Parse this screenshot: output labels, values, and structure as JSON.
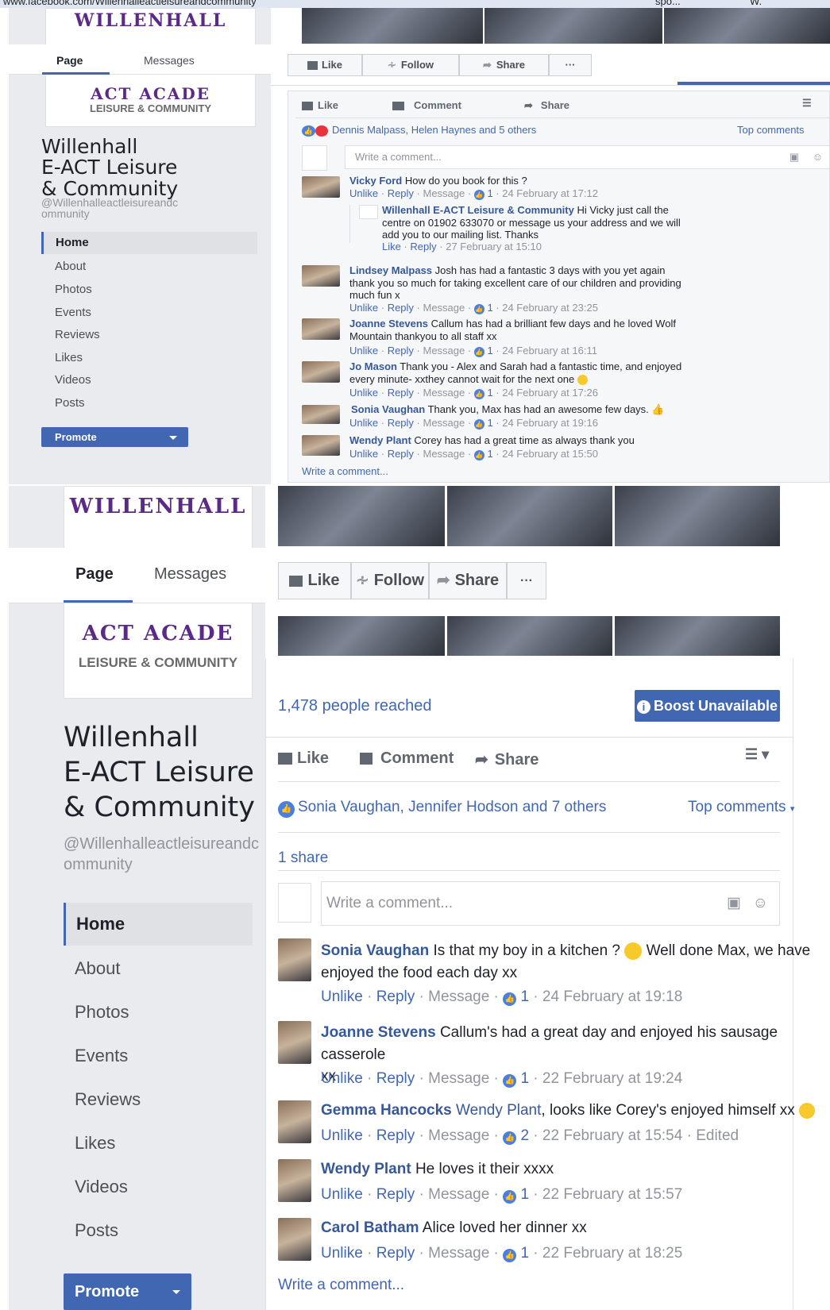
{
  "browser": {
    "address": "www.facebook.com/Willenhalleactleisureandcommunity",
    "tab_text": "spo...",
    "tab2_text": "W."
  },
  "logo": {
    "arc_text": "WILLENHALL",
    "arc_text2": "ACT ACADE",
    "sub_text": "LEISURE & COMMUNITY"
  },
  "page": {
    "tabs": {
      "page": "Page",
      "messages": "Messages"
    },
    "name_lines": [
      "Willenhall",
      "E-ACT Leisure",
      "& Community"
    ],
    "handle_lines": [
      "@Willenhalleactleisureandc",
      "ommunity"
    ],
    "nav": [
      "Home",
      "About",
      "Photos",
      "Events",
      "Reviews",
      "Likes",
      "Videos",
      "Posts"
    ],
    "promote": "Promote"
  },
  "actions": {
    "like": "Like",
    "follow": "Follow",
    "share": "Share",
    "more": "···",
    "comment": "Comment"
  },
  "post1": {
    "reactions_text": "Dennis Malpass, Helen Haynes and 5 others",
    "top_comments": "Top comments",
    "write_placeholder": "Write a comment...",
    "comments": [
      {
        "author": "Vicky Ford",
        "text": "How do you book for this ?",
        "meta": [
          "Unlike",
          "Reply",
          "Message"
        ],
        "likes": "1",
        "time": "24 February at 17:12"
      },
      {
        "author": "Lindsey Malpass",
        "text_lines": [
          "Josh has had a fantastic 3 days with you yet again",
          "thank you so much for taking excellent care of our children and providing",
          "much fun x"
        ],
        "meta": [
          "Unlike",
          "Reply",
          "Message"
        ],
        "likes": "1",
        "time": "24 February at 23:25"
      },
      {
        "author": "Joanne Stevens",
        "text_lines": [
          "Callum has had a brilliant few days and he loved Wolf",
          "Mountain thankyou to all staff xx"
        ],
        "meta": [
          "Unlike",
          "Reply",
          "Message"
        ],
        "likes": "1",
        "time": "24 February at 16:11"
      },
      {
        "author": "Jo Mason",
        "text_lines": [
          "Thank you - Alex and Sarah had a fantastic time, and enjoyed",
          "every minute- xxthey cannot wait for the next one"
        ],
        "meta": [
          "Unlike",
          "Reply",
          "Message"
        ],
        "likes": "1",
        "time": "24 February at 17:26"
      },
      {
        "author": "Sonia Vaughan",
        "text": "Thank you, Max has had an awesome few days.",
        "meta": [
          "Unlike",
          "Reply",
          "Message"
        ],
        "likes": "1",
        "time": "24 February at 19:16"
      },
      {
        "author": "Wendy Plant",
        "text": "Corey has had a great time as always thank you",
        "meta": [
          "Unlike",
          "Reply",
          "Message"
        ],
        "likes": "1",
        "time": "24 February at 15:50"
      }
    ],
    "reply": {
      "author": "Willenhall E-ACT Leisure & Community",
      "text_lines": [
        "Hi Vicky just call the",
        "centre on 01902 633070 or message us your address and we will",
        "add you to our mailing list. Thanks"
      ],
      "meta": [
        "Like",
        "Reply"
      ],
      "time": "27 February at 15:10"
    },
    "write_link": "Write a comment..."
  },
  "post2": {
    "reached": "1,478 people reached",
    "boost": "Boost Unavailable",
    "reactions_text": "Sonia Vaughan, Jennifer Hodson and 7 others",
    "top_comments": "Top comments",
    "shares": "1 share",
    "write_placeholder": "Write a comment...",
    "comments": [
      {
        "author": "Sonia Vaughan",
        "text_lines": [
          "Is that my boy in a kitchen ?",
          "Well done Max, we have",
          "enjoyed the food each day xx"
        ],
        "meta": [
          "Unlike",
          "Reply",
          "Message"
        ],
        "likes": "1",
        "time": "24 February at 19:18",
        "edited": ""
      },
      {
        "author": "Joanne Stevens",
        "text_lines": [
          "Callum's had a great day and enjoyed his sausage casserole",
          "xx"
        ],
        "meta": [
          "Unlike",
          "Reply",
          "Message"
        ],
        "likes": "1",
        "time": "22 February at 19:24",
        "edited": ""
      },
      {
        "author": "Gemma Hancocks",
        "mention": "Wendy Plant",
        "text": ", looks like Corey's enjoyed himself xx",
        "meta": [
          "Unlike",
          "Reply",
          "Message"
        ],
        "likes": "2",
        "time": "22 February at 15:54",
        "edited": "Edited"
      },
      {
        "author": "Wendy Plant",
        "text": "He loves it their xxxx",
        "meta": [
          "Unlike",
          "Reply",
          "Message"
        ],
        "likes": "1",
        "time": "22 February at 15:57",
        "edited": ""
      },
      {
        "author": "Carol Batham",
        "text": "Alice loved her dinner xx",
        "meta": [
          "Unlike",
          "Reply",
          "Message"
        ],
        "likes": "1",
        "time": "22 February at 18:25",
        "edited": ""
      }
    ],
    "write_link": "Write a comment..."
  },
  "colors": {
    "fb_blue": "#4267b2",
    "link": "#365899",
    "sidebar_bg": "#e9ebee",
    "love_red": "#e8333c"
  }
}
